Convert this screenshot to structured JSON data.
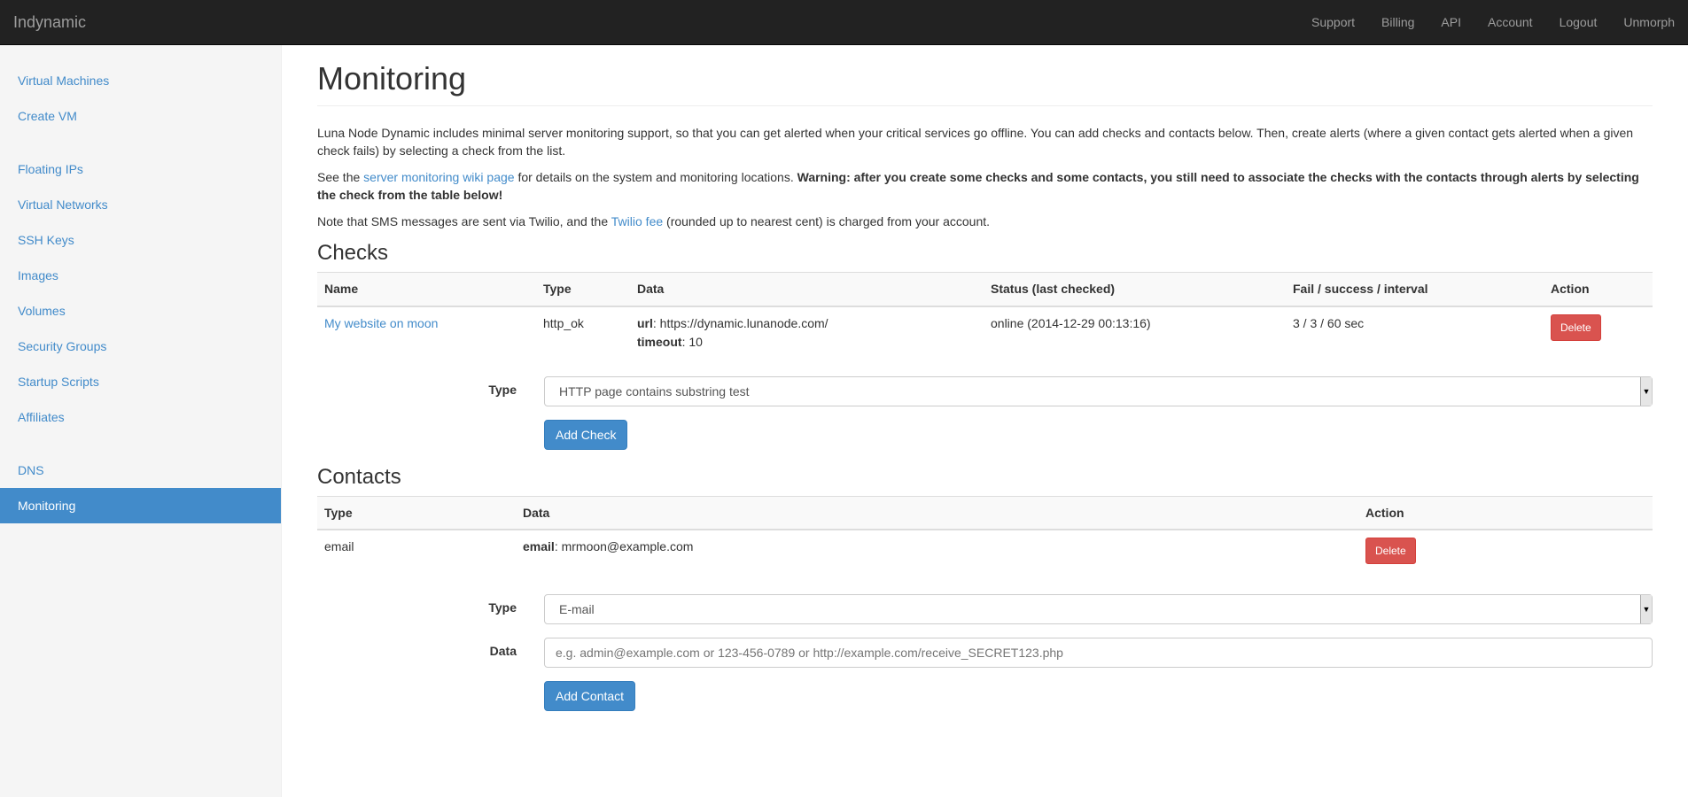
{
  "navbar": {
    "brand": "Indynamic",
    "links": [
      "Support",
      "Billing",
      "API",
      "Account",
      "Logout",
      "Unmorph"
    ]
  },
  "sidebar": {
    "group1": [
      "Virtual Machines",
      "Create VM"
    ],
    "group2": [
      "Floating IPs",
      "Virtual Networks",
      "SSH Keys",
      "Images",
      "Volumes",
      "Security Groups",
      "Startup Scripts",
      "Affiliates"
    ],
    "group3": [
      "DNS",
      "Monitoring"
    ],
    "active": "Monitoring"
  },
  "page": {
    "title": "Monitoring",
    "intro": "Luna Node Dynamic includes minimal server monitoring support, so that you can get alerted when your critical services go offline. You can add checks and contacts below. Then, create alerts (where a given contact gets alerted when a given check fails) by selecting a check from the list.",
    "see_prefix": "See the ",
    "see_link": "server monitoring wiki page",
    "see_suffix": " for details on the system and monitoring locations. ",
    "warning": "Warning: after you create some checks and some contacts, you still need to associate the checks with the contacts through alerts by selecting the check from the table below!",
    "sms_prefix": "Note that SMS messages are sent via Twilio, and the ",
    "sms_link": "Twilio fee",
    "sms_suffix": " (rounded up to nearest cent) is charged from your account."
  },
  "checks": {
    "heading": "Checks",
    "columns": [
      "Name",
      "Type",
      "Data",
      "Status (last checked)",
      "Fail / success / interval",
      "Action"
    ],
    "rows": [
      {
        "name": "My website on moon",
        "type": "http_ok",
        "url_label": "url",
        "url_value": ": https://dynamic.lunanode.com/",
        "timeout_label": "timeout",
        "timeout_value": ": 10",
        "status": "online (2014-12-29 00:13:16)",
        "fsi": "3 / 3 / 60 sec",
        "action": "Delete"
      }
    ],
    "form": {
      "type_label": "Type",
      "type_value": "HTTP page contains substring test",
      "submit": "Add Check"
    }
  },
  "contacts": {
    "heading": "Contacts",
    "columns": [
      "Type",
      "Data",
      "Action"
    ],
    "rows": [
      {
        "type": "email",
        "data_label": "email",
        "data_value": ": mrmoon@example.com",
        "action": "Delete"
      }
    ],
    "form": {
      "type_label": "Type",
      "type_value": "E-mail",
      "data_label": "Data",
      "data_placeholder": "e.g. admin@example.com or 123-456-0789 or http://example.com/receive_SECRET123.php",
      "submit": "Add Contact"
    }
  },
  "colors": {
    "navbar_bg": "#222222",
    "link": "#428bca",
    "danger": "#d9534f",
    "sidebar_bg": "#f5f5f5"
  }
}
